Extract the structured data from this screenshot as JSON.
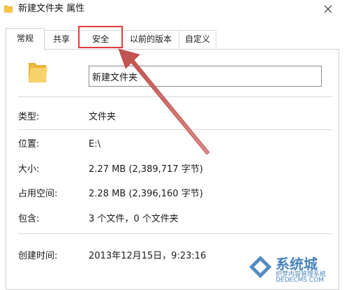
{
  "window": {
    "title": "新建文件夹 属性",
    "folder_icon_color": "#f5c542",
    "close_icon": "close-icon"
  },
  "tabs": [
    {
      "label": "常规",
      "active": true
    },
    {
      "label": "共享",
      "active": false
    },
    {
      "label": "安全",
      "active": false
    },
    {
      "label": "以前的版本",
      "active": false
    },
    {
      "label": "自定义",
      "active": false
    }
  ],
  "general": {
    "folder_name": "新建文件夹",
    "properties": [
      {
        "label": "类型:",
        "value": "文件夹"
      },
      {
        "label": "位置:",
        "value": "E:\\"
      },
      {
        "label": "大小:",
        "value": "2.27 MB (2,389,717 字节)"
      },
      {
        "label": "占用空间:",
        "value": "2.28 MB (2,396,160 字节)"
      },
      {
        "label": "包含:",
        "value": "3 个文件，0 个文件夹"
      },
      {
        "label": "创建时间:",
        "value": "2013年12月15日，9:23:16"
      }
    ]
  },
  "annotation": {
    "highlight_color": "#e23b3b",
    "arrow_color": "#c0504d"
  },
  "watermark": {
    "line1": "系统城",
    "line2": "织梦内容管理系统",
    "line3": "DEDECMS.COM"
  }
}
